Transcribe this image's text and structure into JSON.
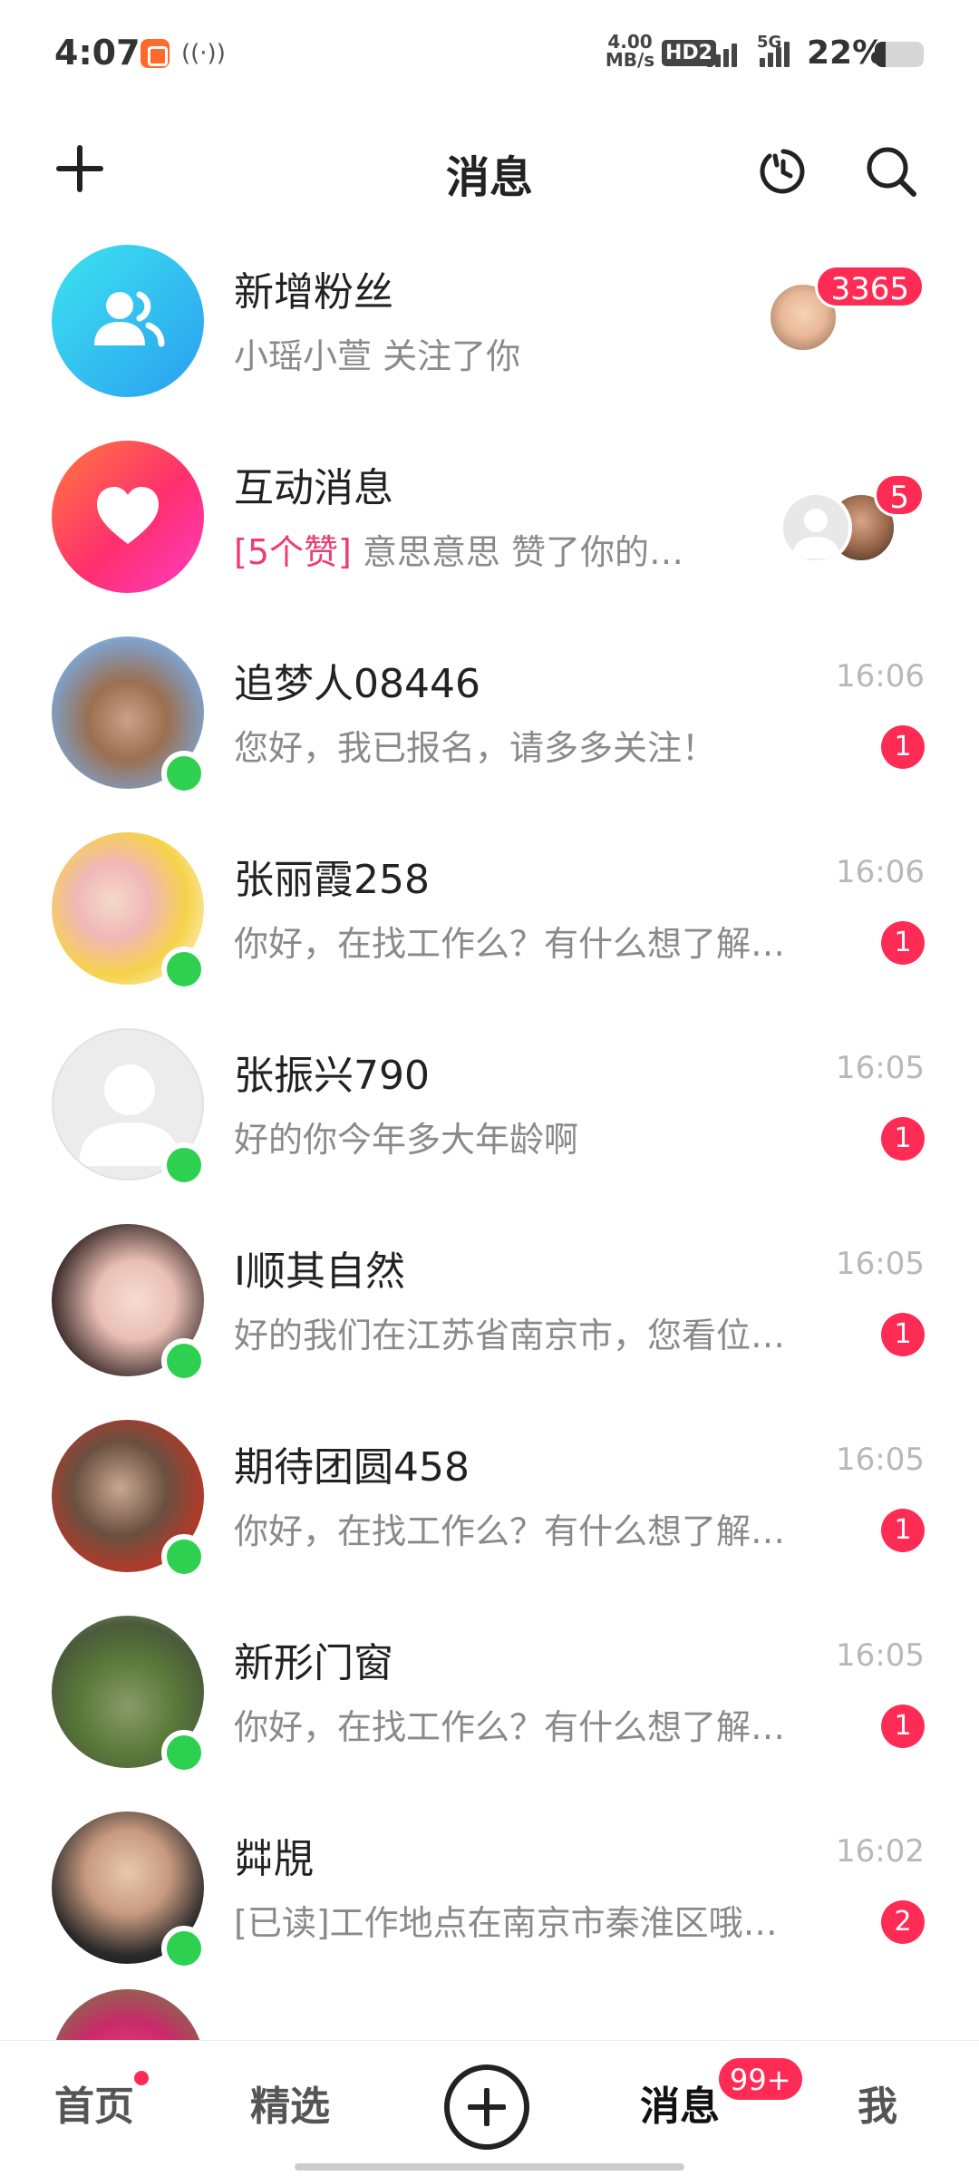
{
  "status_bar": {
    "time": "4:07",
    "speed_value": "4.00",
    "speed_unit": "MB/s",
    "hd": "HD2",
    "network": "5G",
    "battery": "22%",
    "battery_level": 0.22
  },
  "header": {
    "title": "消息"
  },
  "special_rows": [
    {
      "title": "新增粉丝",
      "subtitle": "小瑶小萱 关注了你",
      "badge": "3365"
    },
    {
      "title": "互动消息",
      "tag": "[5个赞]",
      "subtitle": "意思意思 赞了你的…",
      "badge": "5"
    }
  ],
  "messages": [
    {
      "name": "追梦人08446",
      "preview": "您好，我已报名，请多多关注！",
      "time": "16:06",
      "badge": "1"
    },
    {
      "name": "张丽霞258",
      "preview": "你好，在找工作么？有什么想了解…",
      "time": "16:06",
      "badge": "1"
    },
    {
      "name": "张振兴790",
      "preview": "好的你今年多大年龄啊",
      "time": "16:05",
      "badge": "1"
    },
    {
      "name": "I顺其自然",
      "preview": "好的我们在江苏省南京市，您看位…",
      "time": "16:05",
      "badge": "1"
    },
    {
      "name": "期待团圆458",
      "preview": "你好，在找工作么？有什么想了解…",
      "time": "16:05",
      "badge": "1"
    },
    {
      "name": "新形门窗",
      "preview": "你好，在找工作么？有什么想了解…",
      "time": "16:05",
      "badge": "1"
    },
    {
      "name": "茻覑",
      "preview": "[已读]工作地点在南京市秦淮区哦…",
      "time": "16:02",
      "badge": "2"
    }
  ],
  "tabbar": {
    "home": "首页",
    "featured": "精选",
    "messages": "消息",
    "messages_badge": "99+",
    "me": "我"
  }
}
